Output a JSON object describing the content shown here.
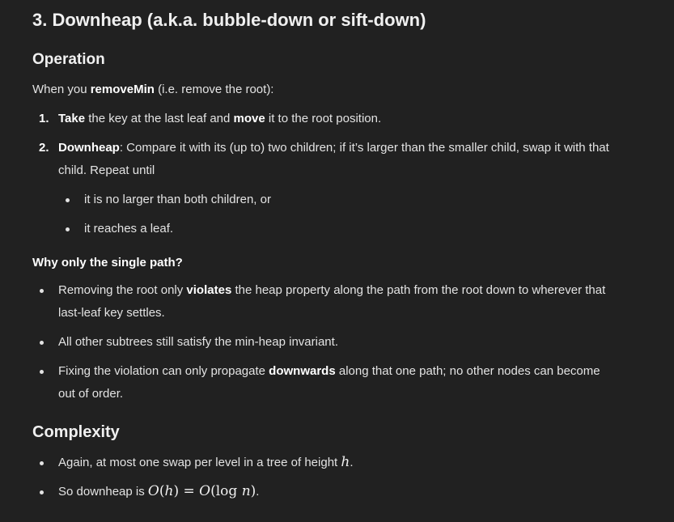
{
  "section_title": "3. Downheap (a.k.a. bubble-down or sift-down)",
  "operation": {
    "heading": "Operation",
    "intro_prefix": "When you ",
    "intro_bold": "removeMin",
    "intro_suffix": " (i.e. remove the root):",
    "steps": [
      {
        "number": "1.",
        "bold1": "Take",
        "text1": " the key at the last leaf and ",
        "bold2": "move",
        "text2": " it to the root position."
      },
      {
        "number": "2.",
        "bold": "Downheap",
        "text_line1": ": Compare it with its (up to) two children; if it’s larger than the smaller child, swap it with that",
        "text_line2": "child. Repeat until",
        "subitems": [
          "it is no larger than both children, or",
          "it reaches a leaf."
        ]
      }
    ]
  },
  "why": {
    "heading": "Why only the single path?",
    "items": [
      {
        "prefix": "Removing the root only ",
        "bold": "violates",
        "suffix_line1": " the heap property along the path from the root down to wherever that",
        "line2": "last-leaf key settles."
      },
      {
        "text": "All other subtrees still satisfy the min-heap invariant."
      },
      {
        "prefix": "Fixing the violation can only propagate ",
        "bold": "downwards",
        "suffix_line1": " along that one path; no other nodes can become",
        "line2": "out of order."
      }
    ]
  },
  "complexity": {
    "heading": "Complexity",
    "item1_text": "Again, at most one swap per level in a tree of height ",
    "item1_math": "h",
    "item1_end": ".",
    "item2_text": "So downheap is ",
    "item2_math_O1": "O",
    "item2_math_paren1": "(",
    "item2_math_h": "h",
    "item2_math_paren2": ")",
    "item2_math_eq": " = ",
    "item2_math_O2": "O",
    "item2_math_log": "(log ",
    "item2_math_n": "n",
    "item2_math_close": ")",
    "item2_end": "."
  }
}
